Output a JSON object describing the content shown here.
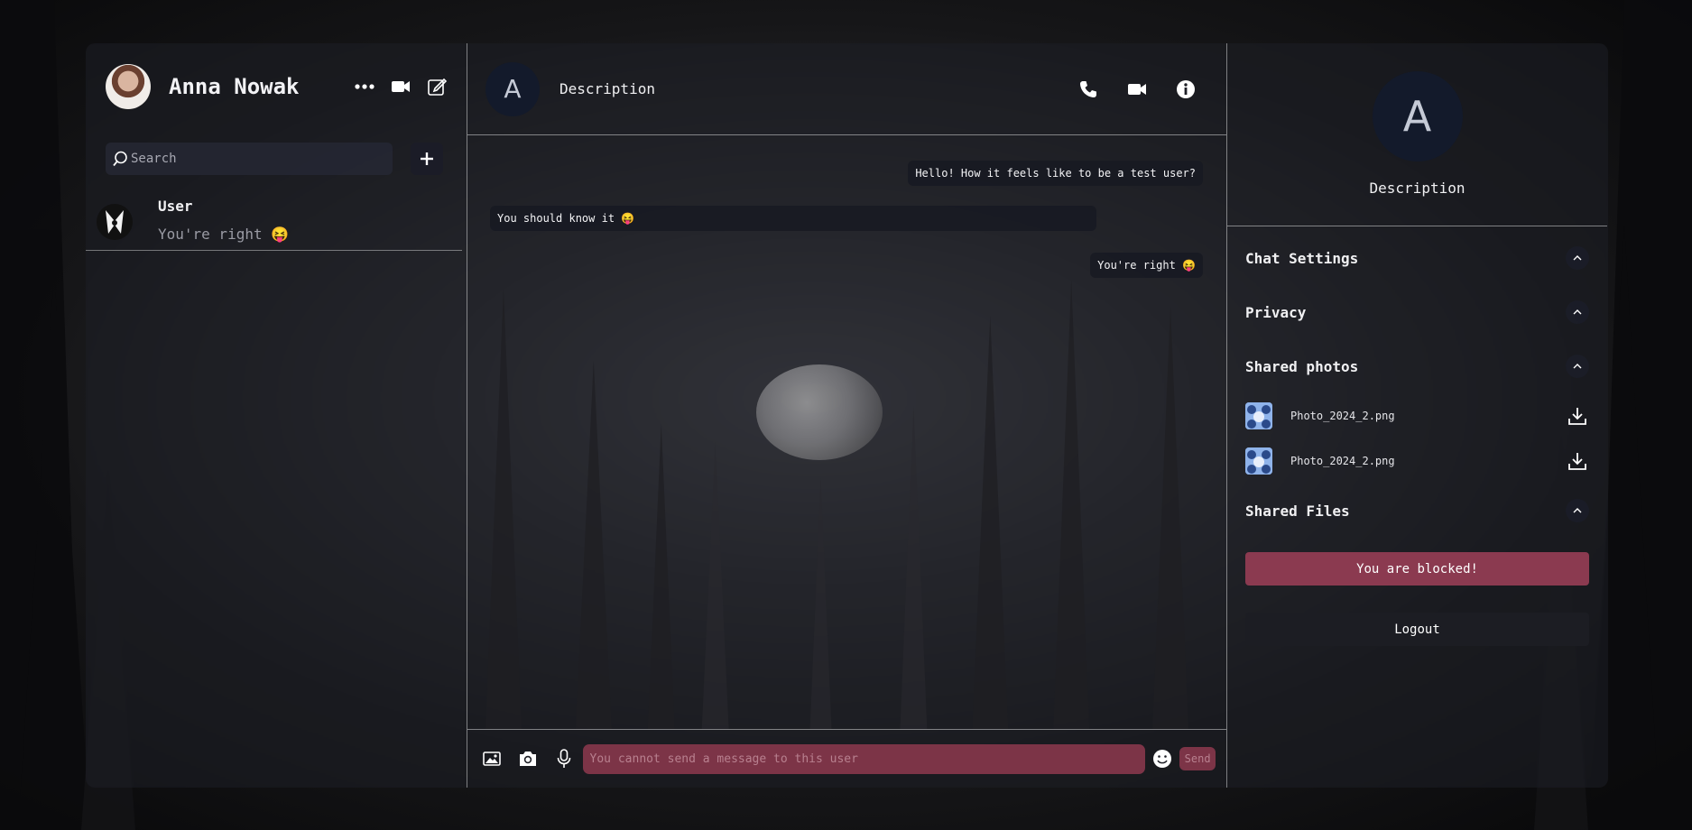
{
  "profile": {
    "name": "Anna Nowak"
  },
  "search": {
    "placeholder": "Search"
  },
  "chat_list": [
    {
      "name": "User",
      "last_message": "You're right 😝"
    }
  ],
  "chat_header": {
    "title": "Description",
    "avatar_letter": "A"
  },
  "messages": [
    {
      "text": "Hello! How it feels like to be a test user?",
      "own": true
    },
    {
      "text": "You should know it 😝",
      "own": false
    },
    {
      "text": "You're right 😝",
      "own": true
    }
  ],
  "composer": {
    "placeholder": "You cannot send a message to this user",
    "send_label": "Send"
  },
  "details": {
    "avatar_letter": "A",
    "title": "Description",
    "sections": {
      "chat_settings": "Chat Settings",
      "privacy": "Privacy",
      "shared_photos": "Shared photos",
      "shared_files": "Shared Files"
    },
    "photos": [
      {
        "name": "Photo_2024_2.png"
      },
      {
        "name": "Photo_2024_2.png"
      }
    ],
    "blocked_label": "You are blocked!",
    "logout_label": "Logout"
  },
  "colors": {
    "blocked": "#8b3a50",
    "input_blocked": "#7c3447",
    "avatar_bg": "#131a2b"
  }
}
